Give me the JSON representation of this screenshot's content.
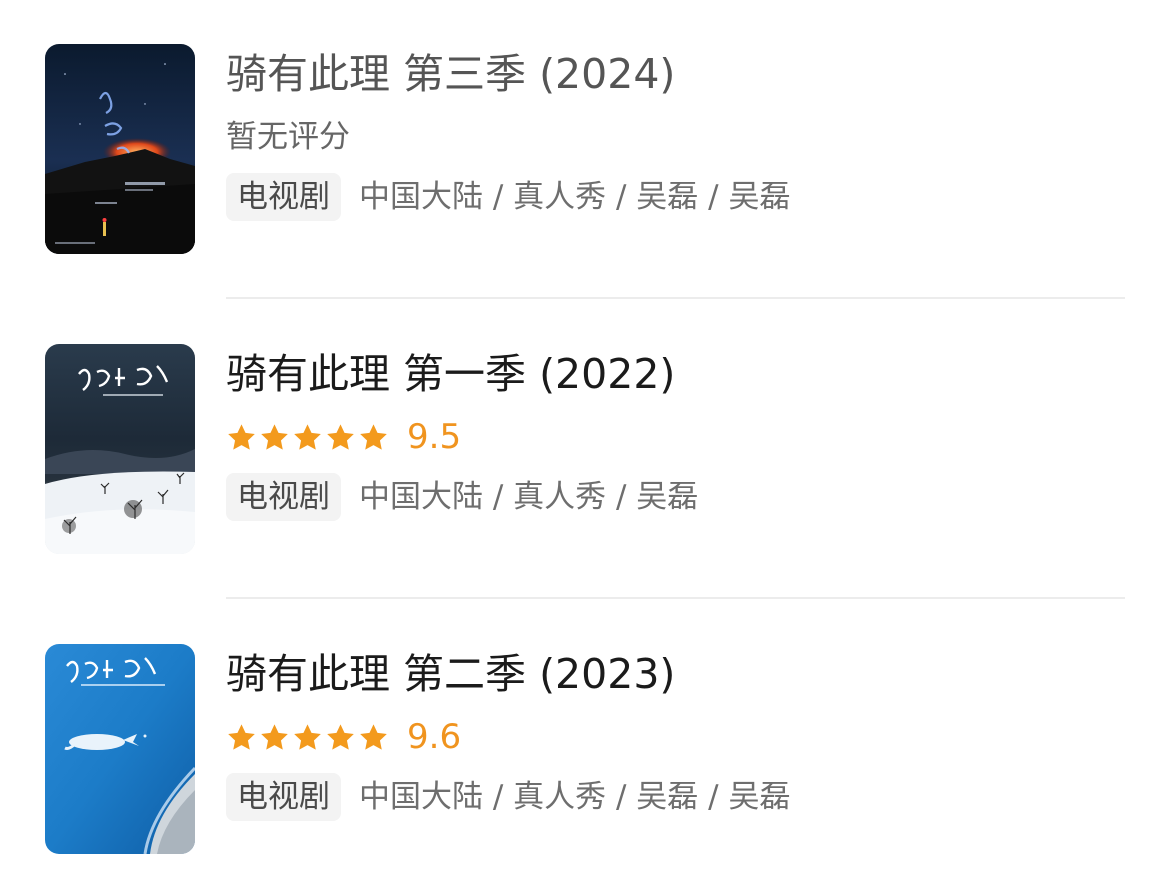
{
  "results": [
    {
      "title": "骑有此理 第三季 (2024)",
      "rating_text": "暂无评分",
      "stars": 0,
      "score": "",
      "tag": "电视剧",
      "meta": "中国大陆 / 真人秀 / 吴磊 / 吴磊",
      "poster_logo": "骑有此理"
    },
    {
      "title": "骑有此理 第一季 (2022)",
      "rating_text": "",
      "stars": 5,
      "score": "9.5",
      "tag": "电视剧",
      "meta": "中国大陆 / 真人秀 / 吴磊",
      "poster_logo": "骑有此理"
    },
    {
      "title": "骑有此理 第二季 (2023)",
      "rating_text": "",
      "stars": 5,
      "score": "9.6",
      "tag": "电视剧",
      "meta": "中国大陆 / 真人秀 / 吴磊 / 吴磊",
      "poster_logo": "骑有此理"
    }
  ],
  "colors": {
    "star": "#f39a1d",
    "score": "#f0941f",
    "tag_bg": "#f3f3f3"
  },
  "icons": {
    "rating": "star-icon"
  }
}
